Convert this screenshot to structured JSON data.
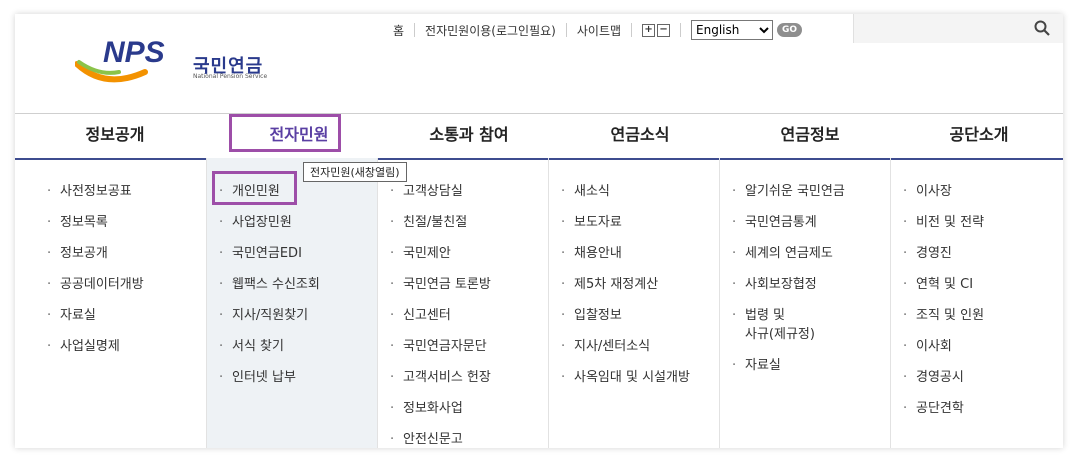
{
  "header": {
    "brand_abbr": "NPS",
    "brand_name": "국민연금",
    "brand_en": "National Pension Service",
    "utils": {
      "home": "홈",
      "eservice": "전자민원이용(로그인필요)",
      "sitemap": "사이트맵",
      "zoom_in": "+",
      "zoom_out": "−",
      "language": "English",
      "go": "GO"
    },
    "search": {
      "placeholder": ""
    }
  },
  "nav": {
    "menus": [
      "정보공개",
      "전자민원",
      "소통과 참여",
      "연금소식",
      "연금정보",
      "공단소개"
    ],
    "active_index": 1
  },
  "tooltip": "전자민원(새창열림)",
  "dropdown": {
    "columns": [
      [
        "사전정보공표",
        "정보목록",
        "정보공개",
        "공공데이터개방",
        "자료실",
        "사업실명제"
      ],
      [
        "개인민원",
        "사업장민원",
        "국민연금EDI",
        "웹팩스 수신조회",
        "지사/직원찾기",
        "서식 찾기",
        "인터넷 납부"
      ],
      [
        "고객상담실",
        "친절/불친절",
        "국민제안",
        "국민연금 토론방",
        "신고센터",
        "국민연금자문단",
        "고객서비스 헌장",
        "정보화사업",
        "안전신문고"
      ],
      [
        "새소식",
        "보도자료",
        "채용안내",
        "제5차 재정계산",
        "입찰정보",
        "지사/센터소식",
        "사옥임대 및 시설개방"
      ],
      [
        "알기쉬운 국민연금",
        "국민연금통계",
        "세계의 연금제도",
        "사회보장협정",
        "법령 및\n사규(제규정)",
        "자료실"
      ],
      [
        "이사장",
        "비전 및 전략",
        "경영진",
        "연혁 및 CI",
        "조직 및 인원",
        "이사회",
        "경영공시",
        "공단견학"
      ]
    ]
  },
  "colors": {
    "accent": "#5a3fa3",
    "highlight": "#9d4ea8",
    "nav_line": "#3e4c8f",
    "brand_blue": "#2a3a8c"
  }
}
